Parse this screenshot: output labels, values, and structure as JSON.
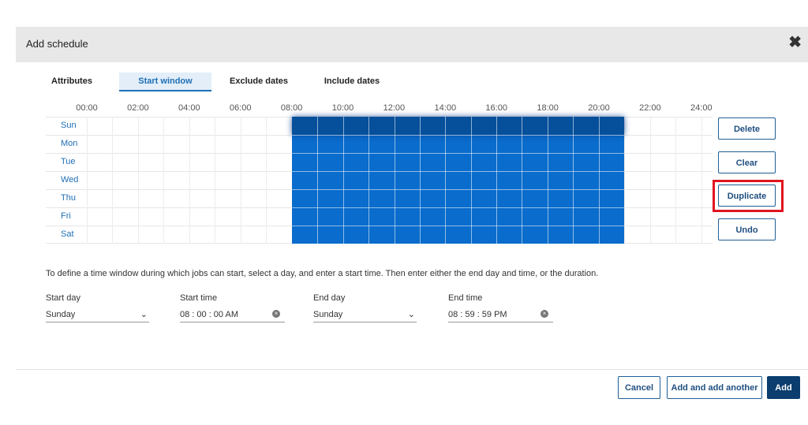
{
  "dialog": {
    "title": "Add schedule",
    "close_icon": "close-icon"
  },
  "tabs": [
    {
      "label": "Attributes",
      "active": false
    },
    {
      "label": "Start window",
      "active": true
    },
    {
      "label": "Exclude dates",
      "active": false
    },
    {
      "label": "Include dates",
      "active": false
    }
  ],
  "schedule_grid": {
    "hours": [
      "00:00",
      "02:00",
      "04:00",
      "06:00",
      "08:00",
      "10:00",
      "12:00",
      "14:00",
      "16:00",
      "18:00",
      "20:00",
      "22:00",
      "24:00"
    ],
    "days": [
      "Sun",
      "Mon",
      "Tue",
      "Wed",
      "Thu",
      "Fri",
      "Sat"
    ],
    "selected_start_hour": 8,
    "selected_end_hour": 21,
    "selected_color": "#0a6ccc"
  },
  "side_buttons": {
    "delete": "Delete",
    "clear": "Clear",
    "duplicate": "Duplicate",
    "undo": "Undo"
  },
  "instructions": "To define a time window during which jobs can start, select a day, and enter a start time. Then enter either the end day and time, or the duration.",
  "form": {
    "start_day": {
      "label": "Start day",
      "value": "Sunday"
    },
    "start_time": {
      "label": "Start time",
      "value": "08 : 00 : 00  AM"
    },
    "end_day": {
      "label": "End day",
      "value": "Sunday"
    },
    "end_time": {
      "label": "End time",
      "value": "08 : 59 : 59  PM"
    }
  },
  "footer": {
    "cancel": "Cancel",
    "add_another": "Add and add another",
    "add": "Add"
  }
}
